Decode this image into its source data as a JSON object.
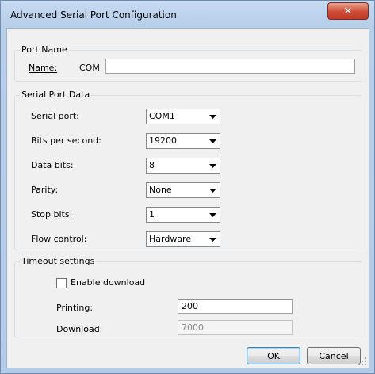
{
  "window": {
    "title": "Advanced Serial Port Configuration",
    "close_glyph": "✕"
  },
  "port_name": {
    "group_label": "Port Name",
    "name_label": "Name:",
    "name_prefix": "COM",
    "name_value": ""
  },
  "serial_port_data": {
    "group_label": "Serial Port Data",
    "fields": [
      {
        "label": "Serial port:",
        "value": "COM1"
      },
      {
        "label": "Bits per second:",
        "value": "19200"
      },
      {
        "label": "Data bits:",
        "value": "8"
      },
      {
        "label": "Parity:",
        "value": "None"
      },
      {
        "label": "Stop bits:",
        "value": "1"
      },
      {
        "label": "Flow control:",
        "value": "Hardware"
      }
    ]
  },
  "timeout": {
    "group_label": "Timeout settings",
    "enable_download_label": "Enable download",
    "enable_download_checked": false,
    "printing_label": "Printing:",
    "printing_value": "200",
    "download_label": "Download:",
    "download_value": "7000"
  },
  "buttons": {
    "ok": "OK",
    "cancel": "Cancel"
  },
  "colors": {
    "title_bar": "#b8cfea",
    "client_bg": "#f0f0f0",
    "close_button": "#cf4b35"
  }
}
